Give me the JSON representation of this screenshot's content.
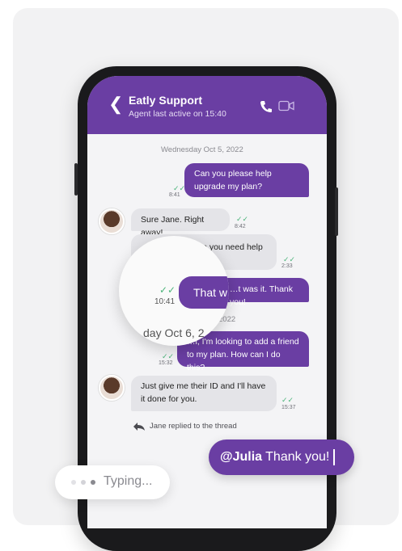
{
  "header": {
    "title": "Eatly Support",
    "subtitle": "Agent last active on 15:40"
  },
  "chat": {
    "date_1": "Wednesday Oct 5, 2022",
    "msg_1": {
      "text": "Can you please help upgrade my plan?",
      "time": "8:41"
    },
    "msg_2": {
      "text": "Sure Jane. Right away!",
      "time": "8:42"
    },
    "msg_3": {
      "text": "…lse you need help",
      "time": "2:33"
    },
    "msg_4": {
      "text": "…t was it. Thank you!"
    },
    "date_2_visible": "2022",
    "msg_5": {
      "text": "…i, I'm looking to add a friend to my plan. How can I do this?",
      "time": "15:32"
    },
    "msg_6": {
      "text": "Just give me their ID and I'll have it done for you.",
      "time": "15:37"
    },
    "replied_note": "Jane replied to the thread"
  },
  "magnifier": {
    "bubble_text": "That w",
    "time": "10:41",
    "date_text": "day Oct 6, 2"
  },
  "reply": {
    "mention": "@Julia",
    "text": " Thank you!"
  },
  "typing": {
    "label": "Typing..."
  },
  "colors": {
    "brand": "#6a3ea3",
    "bubble_in": "#e4e4e8",
    "read_check": "#4cb47a"
  },
  "icons": [
    "back-chevron-icon",
    "phone-icon",
    "video-icon",
    "check-icon",
    "reply-icon"
  ]
}
